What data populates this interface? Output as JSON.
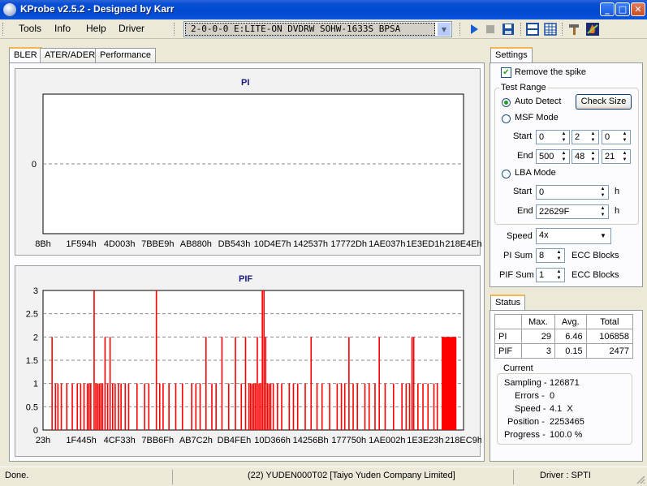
{
  "window": {
    "title": "KProbe v2.5.2 - Designed by Karr",
    "min_icon": "minimize-icon",
    "max_icon": "maximize-icon",
    "close_icon": "close-icon"
  },
  "menu": [
    "Tools",
    "Info",
    "Help",
    "Driver"
  ],
  "drive": {
    "selected": "2-0-0-0 E:LITE-ON DVDRW SOHW-1633S BPSA"
  },
  "toolbar_icons": [
    "play-icon",
    "stop-icon",
    "save-icon",
    "layout-icon",
    "table-icon",
    "tools-icon",
    "flame-icon"
  ],
  "tabs": [
    "BLER",
    "ATER/ADER",
    "Performance"
  ],
  "settings": {
    "tab": "Settings",
    "remove_spike": "Remove the spike",
    "test_range": "Test Range",
    "auto_detect": "Auto Detect",
    "check_size": "Check Size",
    "msf_mode": "MSF Mode",
    "start_label": "Start",
    "end_label": "End",
    "msf_start": [
      "0",
      "2",
      "0"
    ],
    "msf_end": [
      "500",
      "48",
      "21"
    ],
    "lba_mode": "LBA Mode",
    "lba_start": "0",
    "lba_end": "22629F",
    "unit_h": "h",
    "speed_label": "Speed",
    "speed": "4x",
    "pi_sum_label": "PI Sum",
    "pi_sum": "8",
    "pif_sum_label": "PIF Sum",
    "pif_sum": "1",
    "ecc_blocks": "ECC Blocks"
  },
  "status": {
    "tab": "Status",
    "headers": [
      "",
      "Max.",
      "Avg.",
      "Total"
    ],
    "rows": [
      [
        "PI",
        "29",
        "6.46",
        "106858"
      ],
      [
        "PIF",
        "3",
        "0.15",
        "2477"
      ]
    ],
    "current_label": "Current",
    "sampling_label": "Sampling -",
    "sampling": "126871",
    "errors_label": "Errors -",
    "errors": "0",
    "speed_label": "Speed -",
    "speed": "4.1  X",
    "position_label": "Position -",
    "position": "2253465",
    "progress_label": "Progress -",
    "progress": "100.0 %"
  },
  "statusbar": {
    "left": "Done.",
    "center": "(22) YUDEN000T02 [Taiyo Yuden Company Limited]",
    "right": "Driver : SPTI"
  },
  "chart_data": [
    {
      "type": "line",
      "title": "PI",
      "y_ticks": [
        "0"
      ],
      "x_ticks": [
        "8Bh",
        "1F594h",
        "4D003h",
        "7BBE9h",
        "AB880h",
        "DB543h",
        "10D4E7h",
        "142537h",
        "17772Dh",
        "1AE037h",
        "1E3ED1h",
        "218E4Eh"
      ],
      "series": [
        {
          "values": []
        }
      ]
    },
    {
      "type": "bar",
      "title": "PIF",
      "ylim": [
        0,
        3
      ],
      "y_ticks": [
        "0",
        "0.5",
        "1",
        "1.5",
        "2",
        "2.5",
        "3"
      ],
      "x_ticks": [
        "23h",
        "1F445h",
        "4CF33h",
        "7BB6Fh",
        "AB7C2h",
        "DB4FEh",
        "10D366h",
        "14256Bh",
        "177750h",
        "1AE002h",
        "1E3E23h",
        "218EC9h"
      ],
      "x_range": [
        0,
        1000
      ],
      "series": [
        {
          "color": "#ff0000",
          "points": [
            [
              20,
              2
            ],
            [
              28,
              1
            ],
            [
              34,
              1
            ],
            [
              42,
              1
            ],
            [
              55,
              1
            ],
            [
              68,
              1
            ],
            [
              80,
              1
            ],
            [
              88,
              1
            ],
            [
              96,
              1
            ],
            [
              104,
              1
            ],
            [
              108,
              1
            ],
            [
              112,
              1
            ],
            [
              120,
              3
            ],
            [
              124,
              1
            ],
            [
              128,
              1
            ],
            [
              132,
              1
            ],
            [
              136,
              1
            ],
            [
              140,
              1
            ],
            [
              146,
              2
            ],
            [
              152,
              1
            ],
            [
              158,
              2
            ],
            [
              164,
              1
            ],
            [
              170,
              1
            ],
            [
              178,
              1
            ],
            [
              184,
              1
            ],
            [
              194,
              1
            ],
            [
              202,
              1
            ],
            [
              222,
              1
            ],
            [
              240,
              1
            ],
            [
              250,
              1
            ],
            [
              268,
              3
            ],
            [
              276,
              1
            ],
            [
              284,
              1
            ],
            [
              298,
              1
            ],
            [
              314,
              1
            ],
            [
              330,
              1
            ],
            [
              352,
              1
            ],
            [
              362,
              1
            ],
            [
              372,
              1
            ],
            [
              386,
              2
            ],
            [
              400,
              1
            ],
            [
              410,
              1
            ],
            [
              424,
              2
            ],
            [
              440,
              1
            ],
            [
              456,
              2
            ],
            [
              470,
              1
            ],
            [
              480,
              2
            ],
            [
              488,
              1
            ],
            [
              492,
              1
            ],
            [
              496,
              1
            ],
            [
              500,
              1
            ],
            [
              504,
              1
            ],
            [
              508,
              2
            ],
            [
              512,
              1
            ],
            [
              516,
              1
            ],
            [
              520,
              3
            ],
            [
              524,
              3
            ],
            [
              528,
              2
            ],
            [
              532,
              1
            ],
            [
              536,
              1
            ],
            [
              540,
              1
            ],
            [
              546,
              1
            ],
            [
              556,
              1
            ],
            [
              566,
              1
            ],
            [
              584,
              1
            ],
            [
              594,
              1
            ],
            [
              604,
              1
            ],
            [
              622,
              1
            ],
            [
              636,
              2
            ],
            [
              650,
              1
            ],
            [
              662,
              1
            ],
            [
              680,
              1
            ],
            [
              698,
              1
            ],
            [
              708,
              1
            ],
            [
              716,
              1
            ],
            [
              726,
              2
            ],
            [
              736,
              1
            ],
            [
              746,
              1
            ],
            [
              764,
              1
            ],
            [
              774,
              1
            ],
            [
              788,
              1
            ],
            [
              798,
              2
            ],
            [
              812,
              1
            ],
            [
              832,
              1
            ],
            [
              852,
              1
            ],
            [
              862,
              1
            ],
            [
              870,
              1
            ],
            [
              876,
              2
            ],
            [
              880,
              2
            ],
            [
              890,
              1
            ],
            [
              902,
              1
            ],
            [
              914,
              1
            ],
            [
              928,
              1
            ],
            [
              936,
              1
            ],
            [
              948,
              2
            ],
            [
              950,
              2
            ],
            [
              952,
              2
            ],
            [
              954,
              2
            ],
            [
              956,
              2
            ],
            [
              958,
              2
            ],
            [
              960,
              2
            ],
            [
              962,
              2
            ],
            [
              964,
              2
            ],
            [
              966,
              2
            ],
            [
              968,
              2
            ],
            [
              970,
              2
            ],
            [
              972,
              2
            ],
            [
              974,
              2
            ],
            [
              976,
              2
            ],
            [
              978,
              2
            ],
            [
              980,
              2
            ]
          ]
        }
      ]
    }
  ]
}
